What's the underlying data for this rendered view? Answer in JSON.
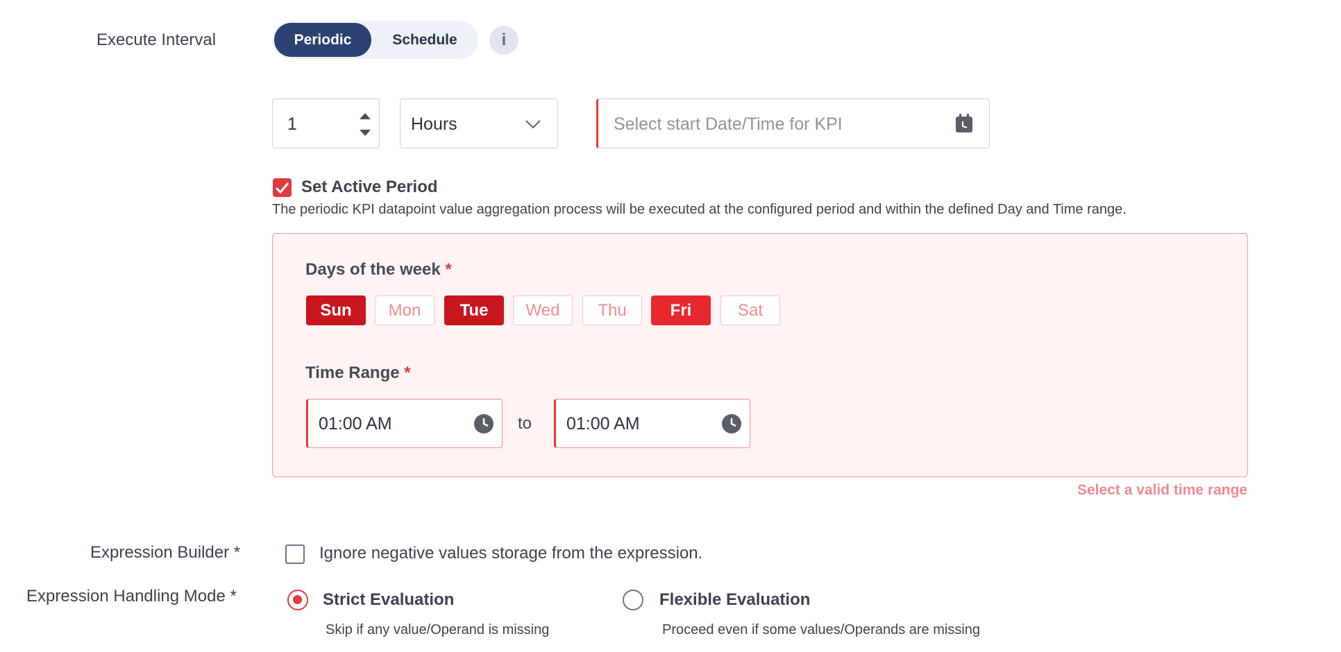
{
  "execute_interval": {
    "label": "Execute Interval",
    "options": [
      "Periodic",
      "Schedule"
    ],
    "selected": "Periodic",
    "info_icon": "i"
  },
  "interval": {
    "value": "1",
    "unit": "Hours",
    "start_placeholder": "Select start Date/Time for KPI"
  },
  "active_period": {
    "checked": true,
    "label": "Set Active Period",
    "description": "The periodic KPI datapoint value aggregation process will be executed at the configured period and within the defined Day and Time range.",
    "days_title": "Days of the week",
    "required_mark": "*",
    "days": [
      {
        "label": "Sun",
        "selected": true
      },
      {
        "label": "Mon",
        "selected": false
      },
      {
        "label": "Tue",
        "selected": true
      },
      {
        "label": "Wed",
        "selected": false
      },
      {
        "label": "Thu",
        "selected": false
      },
      {
        "label": "Fri",
        "selected": true
      },
      {
        "label": "Sat",
        "selected": false
      }
    ],
    "time_range_title": "Time Range",
    "time_from": "01:00 AM",
    "time_separator": "to",
    "time_to": "01:00 AM",
    "error": "Select a valid time range"
  },
  "expression_builder": {
    "label": "Expression Builder *",
    "checkbox_label": "Ignore negative values storage from the expression.",
    "checked": false
  },
  "expression_handling": {
    "label": "Expression Handling Mode *",
    "options": [
      {
        "title": "Strict Evaluation",
        "subtitle": "Skip if any value/Operand is missing",
        "selected": true
      },
      {
        "title": "Flexible Evaluation",
        "subtitle": "Proceed even if some values/Operands are missing",
        "selected": false
      }
    ]
  },
  "colors": {
    "primary_navy": "#2b4272",
    "accent_red": "#e03a3e",
    "day_selected": "#c8161f",
    "panel_bg": "#fff3f4",
    "error_text": "#ef8a90"
  },
  "icons": [
    "info-icon",
    "spinner-up-icon",
    "spinner-down-icon",
    "chevron-down-icon",
    "calendar-clock-icon",
    "checkmark-icon",
    "clock-icon"
  ]
}
